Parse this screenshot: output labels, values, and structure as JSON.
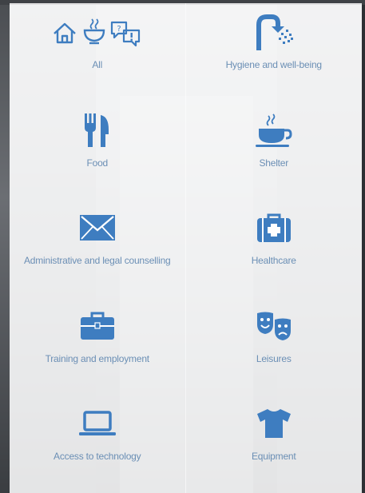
{
  "categories": [
    {
      "label": "All",
      "icon": "home-food-chat-icons"
    },
    {
      "label": "Hygiene and well-being",
      "icon": "shower-icon"
    },
    {
      "label": "Food",
      "icon": "utensils-icon"
    },
    {
      "label": "Shelter",
      "icon": "hot-cup-icon"
    },
    {
      "label": "Administrative and legal counselling",
      "icon": "envelope-icon"
    },
    {
      "label": "Healthcare",
      "icon": "medical-kit-icon"
    },
    {
      "label": "Training and employment",
      "icon": "briefcase-icon"
    },
    {
      "label": "Leisures",
      "icon": "theater-masks-icon"
    },
    {
      "label": "Access to technology",
      "icon": "laptop-icon"
    },
    {
      "label": "Equipment",
      "icon": "tshirt-icon"
    }
  ],
  "colors": {
    "icon": "#3e7dc0",
    "label": "#6b8fb5"
  }
}
